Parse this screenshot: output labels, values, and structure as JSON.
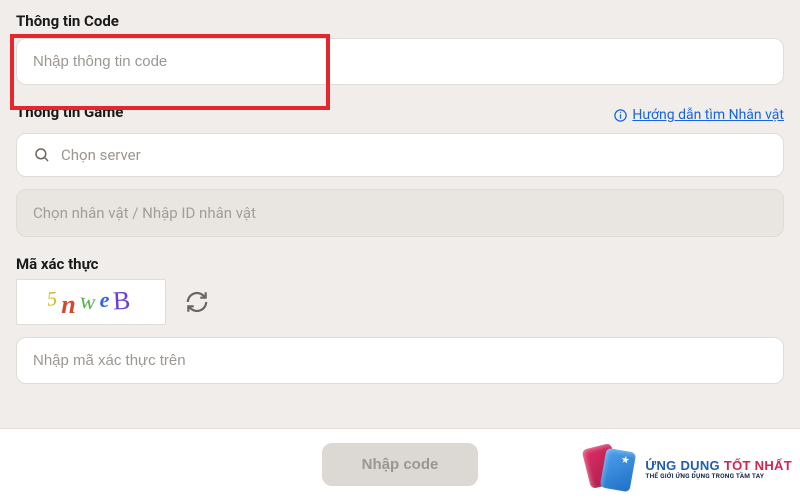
{
  "sections": {
    "code": {
      "label": "Thông tin Code",
      "input_placeholder": "Nhập thông tin code"
    },
    "game": {
      "label": "Thông tin Game",
      "help_link": "Hướng dẫn tìm Nhân vật",
      "server_placeholder": "Chọn server",
      "character_placeholder": "Chọn nhân vật / Nhập ID nhân vật"
    },
    "captcha": {
      "label": "Mã xác thực",
      "chars": [
        "5",
        "n",
        "w",
        "e",
        "B"
      ],
      "input_placeholder": "Nhập mã xác thực trên"
    }
  },
  "submit_label": "Nhập code",
  "watermark": {
    "title_1": "ỨNG DỤNG ",
    "title_2": "TỐT NHẤT",
    "subtitle": "THẾ GIỚI ỨNG DỤNG TRONG TẦM TAY"
  }
}
